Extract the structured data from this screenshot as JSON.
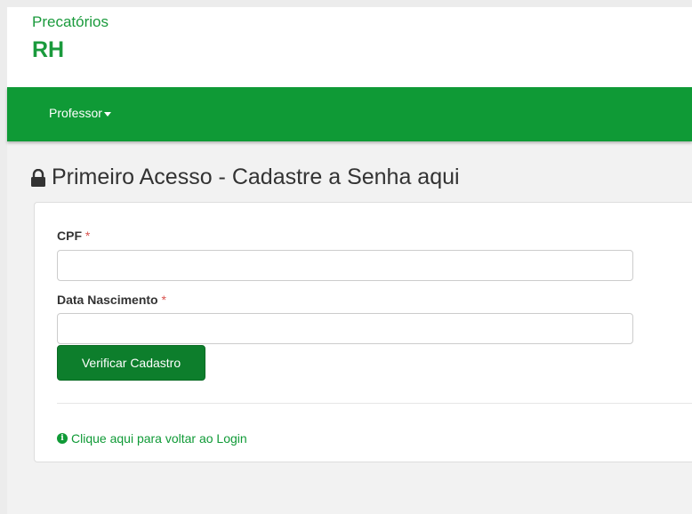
{
  "brand": {
    "line1": "Precatórios",
    "line2": "RH"
  },
  "nav": {
    "items": [
      {
        "label": "Professor",
        "icon": "caret-down-icon"
      }
    ]
  },
  "page": {
    "title": "Primeiro Acesso - Cadastre a Senha aqui",
    "title_icon": "lock-icon"
  },
  "form": {
    "cpf": {
      "label": "CPF",
      "required_mark": "*",
      "value": "",
      "placeholder": ""
    },
    "birth_date": {
      "label": "Data Nascimento",
      "required_mark": "*",
      "value": "",
      "placeholder": ""
    },
    "submit_label": "Verificar Cadastro"
  },
  "footer_link": {
    "label": "Clique aqui para voltar ao Login",
    "icon": "info-circle-icon"
  },
  "colors": {
    "brand_green": "#0f9a36",
    "button_green": "#0d7e2c",
    "required_red": "#d9534f"
  }
}
